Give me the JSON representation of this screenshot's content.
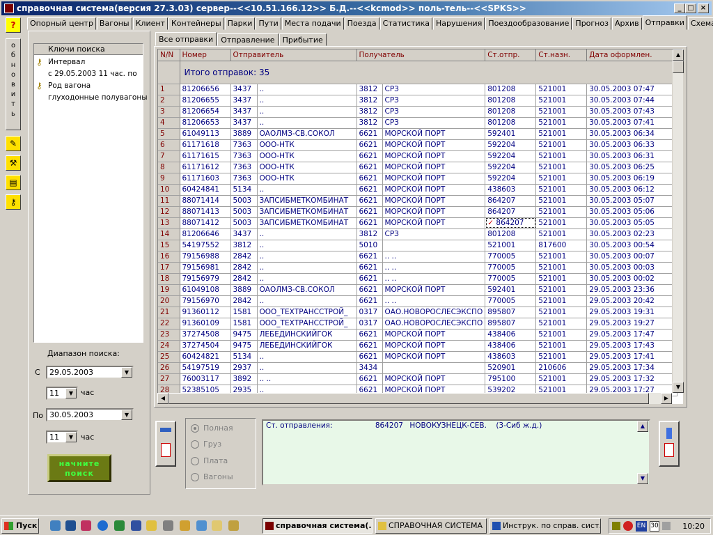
{
  "window": {
    "title": "справочная система(версия 27.3.03) сервер--<<10.51.166.12>> Б.Д.--<<kcmod>> поль-тель--<<SPKS>>",
    "minimize_label": "_",
    "maximize_label": "□",
    "close_label": "×"
  },
  "toolbar": {
    "help_label": "?",
    "refresh_label": "обновить"
  },
  "main_tabs": [
    "Опорный центр",
    "Вагоны",
    "Клиент",
    "Контейнеры",
    "Парки",
    "Пути",
    "Места подачи",
    "Поезда",
    "Статистика",
    "Нарушения",
    "Поездообразование",
    "Прогноз",
    "Архив",
    "Отправки",
    "Схема ОЦ"
  ],
  "active_main_tab": "Отправки",
  "search_keys": {
    "header": "Ключи поиска",
    "items": [
      {
        "label": "Интервал",
        "value": "с 29.05.2003   11 час.  по"
      },
      {
        "label": "Род вагона",
        "value": "глуходонные полувагоны"
      }
    ]
  },
  "range": {
    "title": "Диапазон поиска:",
    "from_label": "С",
    "from_date": "29.05.2003",
    "from_hour": "11",
    "to_label": "По",
    "to_date": "30.05.2003",
    "to_hour": "11",
    "hour_unit": "час"
  },
  "search_button": {
    "line1": "начните",
    "line2": "поиск"
  },
  "sub_tabs": [
    "Все отправки",
    "Отправление",
    "Прибытие"
  ],
  "active_sub_tab": "Все отправки",
  "grid": {
    "columns": [
      "N/N",
      "Номер",
      "Отправитель",
      "Получатель",
      "Ст.отпр.",
      "Ст.назн.",
      "Дата оформлен."
    ],
    "total_label": "Итого отправок: 35",
    "rows": [
      [
        "1",
        "81206656",
        "3437",
        "..",
        "3812",
        "СРЗ",
        "801208",
        "521001",
        "30.05.2003  07:47"
      ],
      [
        "2",
        "81206655",
        "3437",
        "..",
        "3812",
        "СРЗ",
        "801208",
        "521001",
        "30.05.2003  07:44"
      ],
      [
        "3",
        "81206654",
        "3437",
        "..",
        "3812",
        "СРЗ",
        "801208",
        "521001",
        "30.05.2003  07:43"
      ],
      [
        "4",
        "81206653",
        "3437",
        "..",
        "3812",
        "СРЗ",
        "801208",
        "521001",
        "30.05.2003  07:41"
      ],
      [
        "5",
        "61049113",
        "3889",
        "ОАОЛМЗ-СВ.СОКОЛ",
        "6621",
        "МОРСКОЙ ПОРТ",
        "592401",
        "521001",
        "30.05.2003  06:34"
      ],
      [
        "6",
        "61171618",
        "7363",
        "ООО-НТК",
        "6621",
        "МОРСКОЙ ПОРТ",
        "592204",
        "521001",
        "30.05.2003  06:33"
      ],
      [
        "7",
        "61171615",
        "7363",
        "ООО-НТК",
        "6621",
        "МОРСКОЙ ПОРТ",
        "592204",
        "521001",
        "30.05.2003  06:31"
      ],
      [
        "8",
        "61171612",
        "7363",
        "ООО-НТК",
        "6621",
        "МОРСКОЙ ПОРТ",
        "592204",
        "521001",
        "30.05.2003  06:25"
      ],
      [
        "9",
        "61171603",
        "7363",
        "ООО-НТК",
        "6621",
        "МОРСКОЙ ПОРТ",
        "592204",
        "521001",
        "30.05.2003  06:19"
      ],
      [
        "10",
        "60424841",
        "5134",
        "..",
        "6621",
        "МОРСКОЙ ПОРТ",
        "438603",
        "521001",
        "30.05.2003  06:12"
      ],
      [
        "11",
        "88071414",
        "5003",
        "ЗАПСИБМЕТКОМБИНАТ",
        "6621",
        "МОРСКОЙ ПОРТ",
        "864207",
        "521001",
        "30.05.2003  05:07"
      ],
      [
        "12",
        "88071413",
        "5003",
        "ЗАПСИБМЕТКОМБИНАТ",
        "6621",
        "МОРСКОЙ ПОРТ",
        "864207",
        "521001",
        "30.05.2003  05:06"
      ],
      [
        "13",
        "88071412",
        "5003",
        "ЗАПСИБМЕТКОМБИНАТ",
        "6621",
        "МОРСКОЙ ПОРТ",
        "864207",
        "521001",
        "30.05.2003  05:05"
      ],
      [
        "14",
        "81206646",
        "3437",
        "..",
        "3812",
        "СРЗ",
        "801208",
        "521001",
        "30.05.2003  02:23"
      ],
      [
        "15",
        "54197552",
        "3812",
        "..",
        "5010",
        "",
        "521001",
        "817600",
        "30.05.2003  00:54"
      ],
      [
        "16",
        "79156988",
        "2842",
        "..",
        "6621",
        ".. ..",
        "770005",
        "521001",
        "30.05.2003  00:07"
      ],
      [
        "17",
        "79156981",
        "2842",
        "..",
        "6621",
        ".. ..",
        "770005",
        "521001",
        "30.05.2003  00:03"
      ],
      [
        "18",
        "79156979",
        "2842",
        "..",
        "6621",
        ".. ..",
        "770005",
        "521001",
        "30.05.2003  00:02"
      ],
      [
        "19",
        "61049108",
        "3889",
        "ОАОЛМЗ-СВ.СОКОЛ",
        "6621",
        "МОРСКОЙ ПОРТ",
        "592401",
        "521001",
        "29.05.2003  23:36"
      ],
      [
        "20",
        "79156970",
        "2842",
        "..",
        "6621",
        ".. ..",
        "770005",
        "521001",
        "29.05.2003  20:42"
      ],
      [
        "21",
        "91360112",
        "1581",
        "ООО_ТЕХТРАНССТРОЙ_",
        "0317",
        "ОАО.НОВОРОСЛЕСЭКСПО",
        "895807",
        "521001",
        "29.05.2003  19:31"
      ],
      [
        "22",
        "91360109",
        "1581",
        "ООО_ТЕХТРАНССТРОЙ_",
        "0317",
        "ОАО.НОВОРОСЛЕСЭКСПО",
        "895807",
        "521001",
        "29.05.2003  19:27"
      ],
      [
        "23",
        "37274508",
        "9475",
        "ЛЕБЕДИНСКИЙГОК",
        "6621",
        "МОРСКОЙ ПОРТ",
        "438406",
        "521001",
        "29.05.2003  17:47"
      ],
      [
        "24",
        "37274504",
        "9475",
        "ЛЕБЕДИНСКИЙГОК",
        "6621",
        "МОРСКОЙ ПОРТ",
        "438406",
        "521001",
        "29.05.2003  17:43"
      ],
      [
        "25",
        "60424821",
        "5134",
        "..",
        "6621",
        "МОРСКОЙ ПОРТ",
        "438603",
        "521001",
        "29.05.2003  17:41"
      ],
      [
        "26",
        "54197519",
        "2937",
        "..",
        "3434",
        "",
        "520901",
        "210606",
        "29.05.2003  17:34"
      ],
      [
        "27",
        "76003117",
        "3892",
        ".. ..",
        "6621",
        "МОРСКОЙ ПОРТ",
        "795100",
        "521001",
        "29.05.2003  17:32"
      ],
      [
        "28",
        "52385105",
        "2935",
        "..",
        "6621",
        "МОРСКОЙ ПОРТ",
        "539202",
        "521001",
        "29.05.2003  17:27"
      ]
    ],
    "marked_row": "13",
    "mark_symbol": "✓"
  },
  "options": {
    "items": [
      "Полная",
      "Груз",
      "Плата",
      "Вагоны"
    ],
    "selected": "Полная"
  },
  "memo": {
    "label": "Ст. отправления:",
    "code": "864207",
    "name": "НОВОКУЗНЕЦК-СЕВ.",
    "region": "(3-Сиб ж.д.)"
  },
  "taskbar": {
    "start_label": "Пуск",
    "tasks": [
      "справочная система(...",
      "СПРАВОЧНАЯ СИСТЕМА",
      "Инструк. по справ. сист..."
    ],
    "active_task": "справочная система(...",
    "clock": "10:20",
    "lang": "EN",
    "day": "30"
  },
  "colors": {
    "titlebar": "#0a246a",
    "grid_text": "#000080",
    "grid_header": "#800000",
    "memo_bg": "#e8f8e8",
    "search_button_text": "#40ff40"
  }
}
